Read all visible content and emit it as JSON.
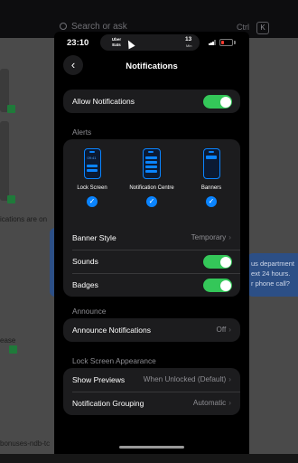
{
  "background": {
    "search_placeholder": "Search or ask",
    "shortcut_ctrl": "Ctrl",
    "shortcut_key": "K",
    "left_text_1": "ications are on",
    "left_text_2": "ease",
    "left_text_3": "bonuses-ndb-tc",
    "bubble_lines": [
      "us department",
      "ext 24 hours.",
      "r phone call?"
    ]
  },
  "status_bar": {
    "time": "23:10",
    "island_app": "Uber Eats",
    "island_number": "13",
    "island_unit": "Min"
  },
  "nav": {
    "back_glyph": "‹",
    "title": "Notifications"
  },
  "allow_notifications": {
    "label": "Allow Notifications",
    "enabled": true
  },
  "alerts": {
    "header": "Alerts",
    "options": [
      {
        "label": "Lock Screen",
        "selected": true,
        "clock": "09:41"
      },
      {
        "label": "Notification Centre",
        "selected": true
      },
      {
        "label": "Banners",
        "selected": true
      }
    ],
    "check_glyph": "✓",
    "banner_style": {
      "label": "Banner Style",
      "value": "Temporary"
    },
    "sounds": {
      "label": "Sounds",
      "enabled": true
    },
    "badges": {
      "label": "Badges",
      "enabled": true
    }
  },
  "announce": {
    "header": "Announce",
    "announce_notifications": {
      "label": "Announce Notifications",
      "value": "Off"
    }
  },
  "lock_screen_appearance": {
    "header": "Lock Screen Appearance",
    "show_previews": {
      "label": "Show Previews",
      "value": "When Unlocked (Default)"
    },
    "notification_grouping": {
      "label": "Notification Grouping",
      "value": "Automatic"
    }
  },
  "chevron_glyph": "›",
  "colors": {
    "accent": "#0a84ff",
    "toggle_on": "#34c759",
    "battery_low": "#ff3b30"
  },
  "icons": [
    "back-icon",
    "cursor-icon",
    "signal-icon",
    "battery-icon",
    "lock-screen-icon",
    "notification-centre-icon",
    "banners-icon",
    "checkmark-icon",
    "chevron-right-icon"
  ]
}
